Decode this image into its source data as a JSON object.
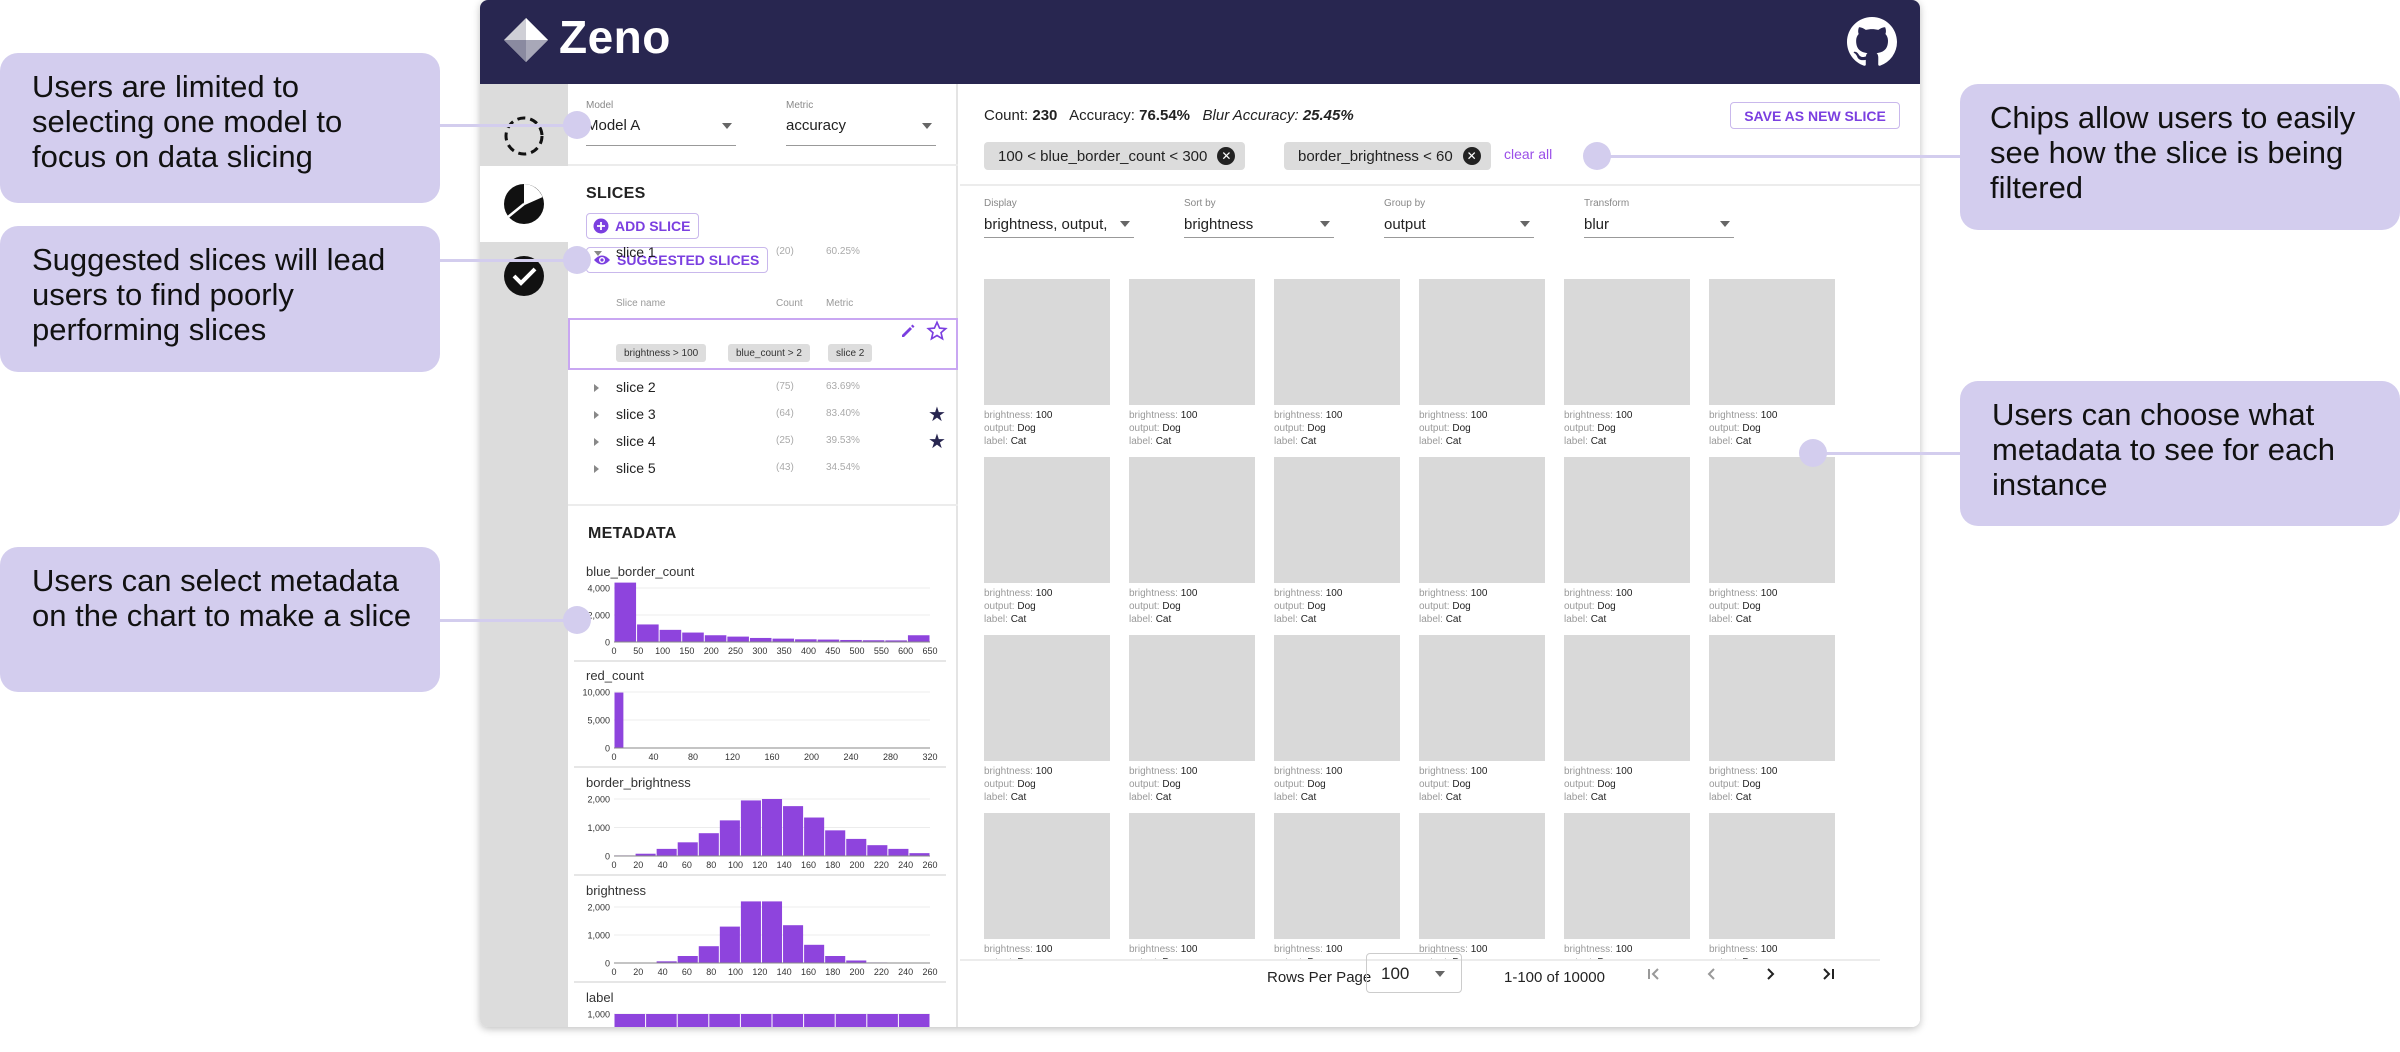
{
  "app": {
    "name": "Zeno"
  },
  "colors": {
    "topbar": "#282650",
    "accent": "#7b3fe0",
    "histogram": "#8e44dd",
    "callout": "#d3cdee"
  },
  "callouts": {
    "model": "Users are limited to selecting one model to focus on data slicing",
    "suggested": "Suggested slices will lead users to find poorly performing slices",
    "metadata_chart": "Users can select metadata on the chart to make a slice",
    "chips": "Chips allow users to easily see how the slice is being filtered",
    "instance_meta": "Users can choose what metadata to see for each instance"
  },
  "sidebar_icons": [
    "dashed-circle-icon",
    "pie-chart-icon",
    "check-circle-icon"
  ],
  "model_select": {
    "label": "Model",
    "value": "Model A"
  },
  "metric_select": {
    "label": "Metric",
    "value": "accuracy"
  },
  "slices": {
    "title": "SLICES",
    "add_label": "ADD SLICE",
    "suggested_label": "SUGGESTED SLICES",
    "col_name": "Slice name",
    "col_count": "Count",
    "col_metric": "Metric",
    "rows": [
      {
        "name": "slice 1",
        "count": "(20)",
        "metric": "60.25%",
        "starred": false,
        "expanded": true
      },
      {
        "name": "slice 2",
        "count": "(75)",
        "metric": "63.69%",
        "starred": false,
        "expanded": false
      },
      {
        "name": "slice 3",
        "count": "(64)",
        "metric": "83.40%",
        "starred": true,
        "expanded": false
      },
      {
        "name": "slice 4",
        "count": "(25)",
        "metric": "39.53%",
        "starred": true,
        "expanded": false
      },
      {
        "name": "slice 5",
        "count": "(43)",
        "metric": "34.54%",
        "starred": false,
        "expanded": false
      }
    ],
    "slice1_chips": [
      "brightness > 100",
      "blue_count > 2",
      "slice 2"
    ]
  },
  "metadata": {
    "title": "METADATA",
    "charts": [
      {
        "name": "blue_border_count",
        "yticks": [
          "4,000",
          "2,000",
          "0"
        ],
        "xticks": [
          "0",
          "50",
          "100",
          "150",
          "200",
          "250",
          "300",
          "350",
          "400",
          "450",
          "500",
          "550",
          "600",
          "650"
        ],
        "ymax": 4000,
        "values": [
          4400,
          1300,
          900,
          700,
          500,
          400,
          300,
          250,
          200,
          180,
          150,
          130,
          120,
          500
        ]
      },
      {
        "name": "red_count",
        "yticks": [
          "10,000",
          "5,000",
          "0"
        ],
        "xticks": [
          "0",
          "40",
          "80",
          "120",
          "160",
          "200",
          "240",
          "280",
          "320"
        ],
        "ymax": 10000,
        "values": [
          9900,
          0,
          0,
          0,
          0,
          0,
          0,
          0,
          0,
          0,
          0,
          0,
          0,
          0,
          0,
          0,
          0,
          0,
          0,
          0,
          0,
          0,
          0,
          0,
          0,
          0,
          0,
          0,
          0,
          0,
          0,
          0
        ]
      },
      {
        "name": "border_brightness",
        "yticks": [
          "2,000",
          "1,000",
          "0"
        ],
        "xticks": [
          "0",
          "20",
          "40",
          "60",
          "80",
          "100",
          "120",
          "140",
          "160",
          "180",
          "200",
          "220",
          "240",
          "260"
        ],
        "ymax": 2000,
        "values": [
          20,
          80,
          250,
          480,
          800,
          1250,
          1950,
          2000,
          1750,
          1350,
          900,
          600,
          380,
          250,
          100
        ]
      },
      {
        "name": "brightness",
        "yticks": [
          "2,000",
          "1,000",
          "0"
        ],
        "xticks": [
          "0",
          "20",
          "40",
          "60",
          "80",
          "100",
          "120",
          "140",
          "160",
          "180",
          "200",
          "220",
          "240",
          "260"
        ],
        "ymax": 2000,
        "values": [
          0,
          10,
          60,
          250,
          600,
          1300,
          2200,
          2200,
          1350,
          650,
          250,
          90,
          20,
          5,
          0
        ]
      },
      {
        "name": "label",
        "yticks": [
          "1,000"
        ],
        "xticks": [],
        "ymax": 1000,
        "values": [
          1000,
          1000,
          1000,
          1000,
          1000,
          1000,
          1000,
          1000,
          1000,
          1000
        ]
      }
    ]
  },
  "summary": {
    "count_label": "Count:",
    "count": "230",
    "acc_label": "Accuracy:",
    "acc": "76.54%",
    "blur_label": "Blur Accuracy:",
    "blur": "25.45%"
  },
  "save_button": "SAVE AS NEW SLICE",
  "filter_chips": [
    "100 < blue_border_count < 300",
    "border_brightness < 60"
  ],
  "clear_all": "clear all",
  "grid_controls": {
    "display": {
      "label": "Display",
      "value": "brightness, output, l"
    },
    "sort": {
      "label": "Sort by",
      "value": "brightness"
    },
    "group": {
      "label": "Group by",
      "value": "output"
    },
    "transform": {
      "label": "Transform",
      "value": "blur"
    }
  },
  "instance": {
    "k1": "brightness:",
    "v1": "100",
    "k2": "output:",
    "v2": "Dog",
    "k3": "label:",
    "v3": "Cat"
  },
  "pagination": {
    "rows_per_page_label": "Rows Per Page",
    "rows_per_page": "100",
    "range": "1-100 of 10000"
  }
}
